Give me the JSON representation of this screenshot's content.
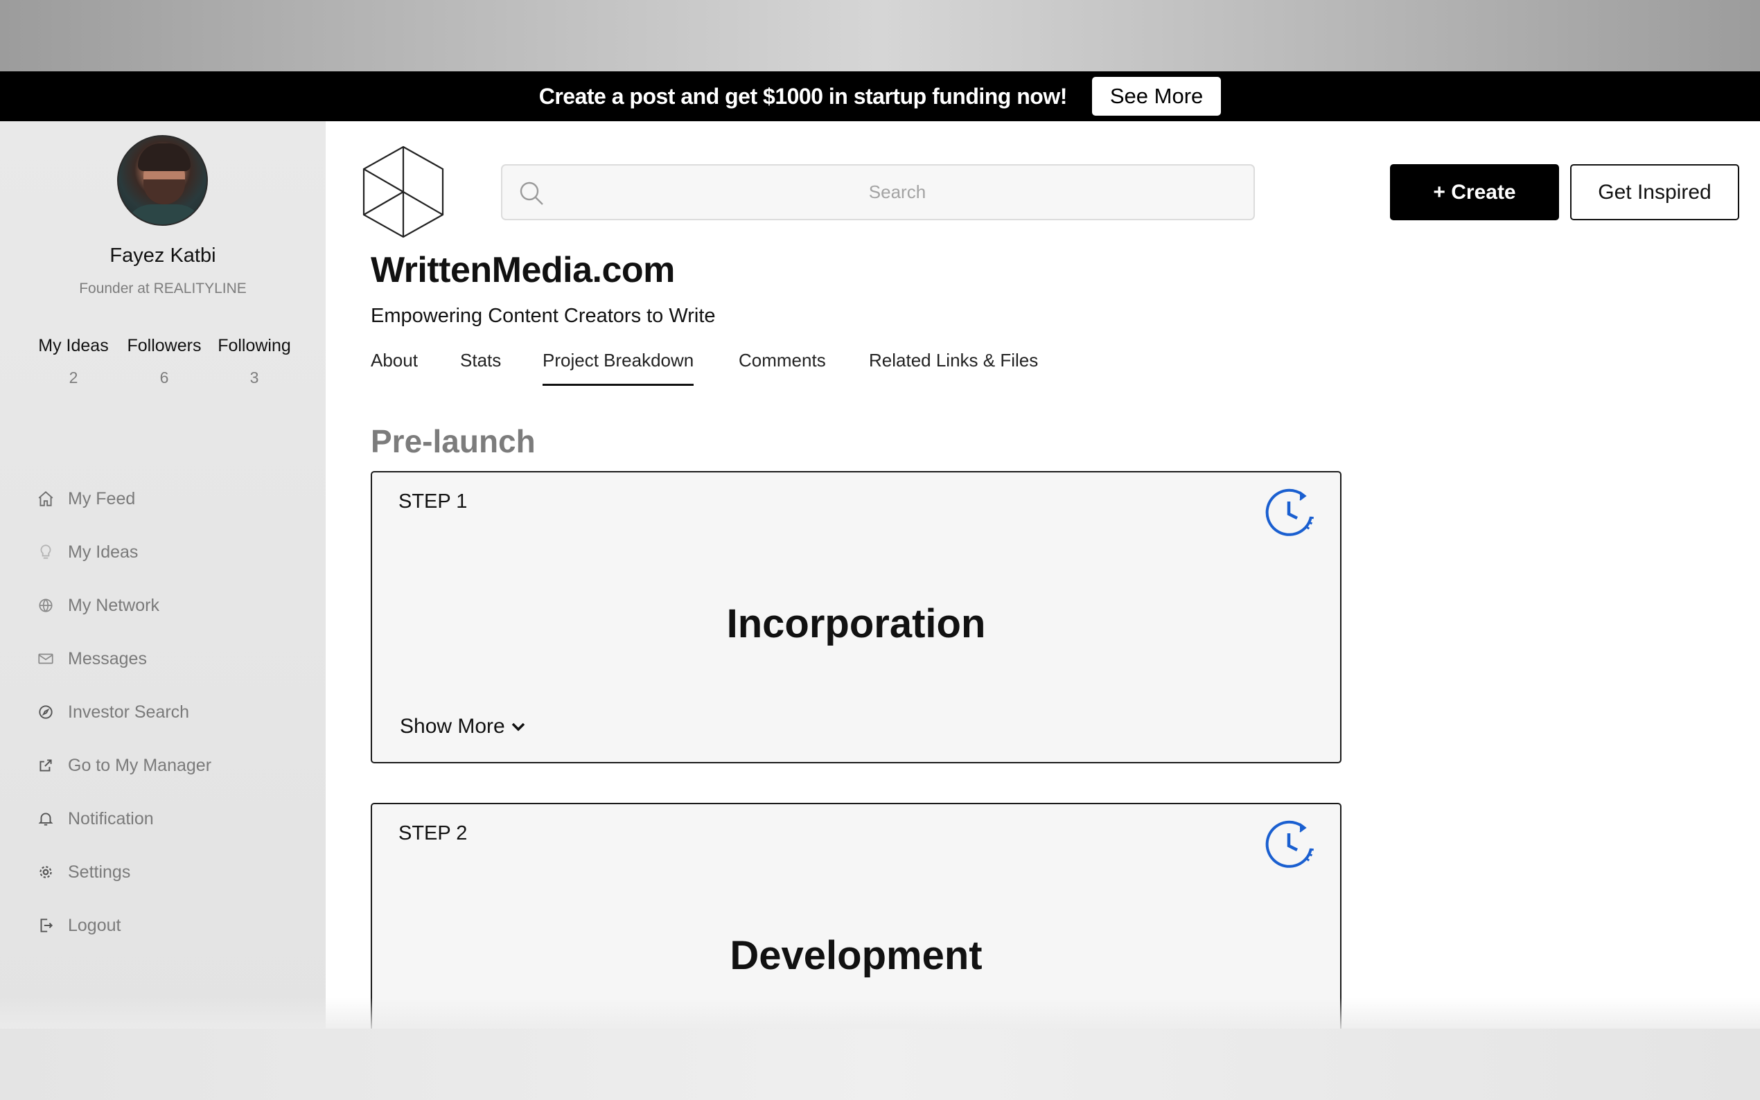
{
  "promo": {
    "text": "Create a post and get $1000 in startup funding now!",
    "button": "See More"
  },
  "profile": {
    "name": "Fayez Katbi",
    "role": "Founder at REALITYLINE",
    "stats": [
      {
        "label": "My Ideas",
        "value": "2"
      },
      {
        "label": "Followers",
        "value": "6"
      },
      {
        "label": "Following",
        "value": "3"
      }
    ]
  },
  "nav": {
    "items": [
      {
        "label": "My Feed",
        "icon": "home-icon"
      },
      {
        "label": "My Ideas",
        "icon": "lightbulb-icon"
      },
      {
        "label": "My Network",
        "icon": "globe-icon"
      },
      {
        "label": "Messages",
        "icon": "envelope-icon"
      },
      {
        "label": "Investor Search",
        "icon": "compass-icon"
      },
      {
        "label": "Go to My Manager",
        "icon": "external-link-icon"
      },
      {
        "label": "Notification",
        "icon": "bell-icon"
      },
      {
        "label": "Settings",
        "icon": "gear-icon"
      },
      {
        "label": "Logout",
        "icon": "logout-icon"
      }
    ]
  },
  "header": {
    "search_placeholder": "Search",
    "create_label": "+ Create",
    "inspired_label": "Get Inspired"
  },
  "project": {
    "title": "WrittenMedia.com",
    "subtitle": "Empowering Content Creators to Write",
    "tabs": [
      "About",
      "Stats",
      "Project Breakdown",
      "Comments",
      "Related Links & Files"
    ],
    "active_tab": "Project Breakdown"
  },
  "breakdown": {
    "section_title": "Pre-launch",
    "steps": [
      {
        "step": "STEP 1",
        "title": "Incorporation",
        "more": "Show More"
      },
      {
        "step": "STEP 2",
        "title": "Development"
      }
    ]
  },
  "colors": {
    "accent_clock": "#1a5fd0",
    "promo_bg": "#000000",
    "sidebar_bg": "#e7e7e7"
  }
}
